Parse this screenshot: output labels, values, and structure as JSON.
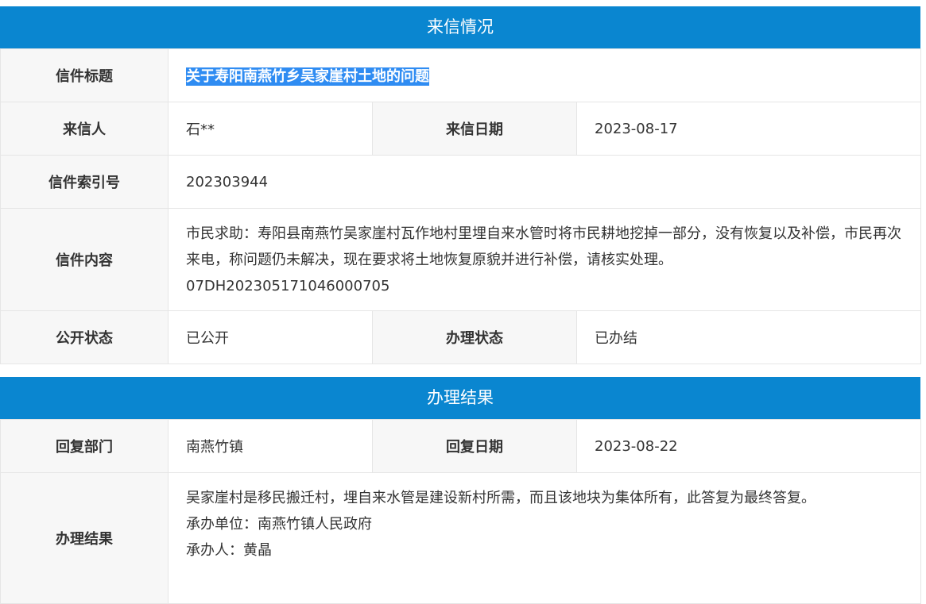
{
  "section1": {
    "header": "来信情况",
    "title_label": "信件标题",
    "title_value": "关于寿阳南燕竹乡吴家崖村土地的问题",
    "sender_label": "来信人",
    "sender_value": "石**",
    "date_label": "来信日期",
    "date_value": "2023-08-17",
    "index_label": "信件索引号",
    "index_value": "202303944",
    "content_label": "信件内容",
    "content_line1": "市民求助：寿阳县南燕竹吴家崖村瓦作地村里埋自来水管时将市民耕地挖掉一部分，没有恢复以及补偿，市民再次来电，称问题仍未解决，现在要求将土地恢复原貌并进行补偿，请核实处理。",
    "content_line2": "07DH202305171046000705",
    "public_label": "公开状态",
    "public_value": "已公开",
    "status_label": "办理状态",
    "status_value": "已办结"
  },
  "section2": {
    "header": "办理结果",
    "dept_label": "回复部门",
    "dept_value": "南燕竹镇",
    "reply_date_label": "回复日期",
    "reply_date_value": "2023-08-22",
    "result_label": "办理结果",
    "result_line1": "吴家崖村是移民搬迁村，埋自来水管是建设新村所需，而且该地块为集体所有，此答复为最终答复。",
    "result_line2": "承办单位：南燕竹镇人民政府",
    "result_line3": "承办人：黄晶"
  },
  "colors": {
    "header_bg": "#0a86d0",
    "label_bg": "#f7f7f7",
    "highlight": "#2f8cf2"
  }
}
